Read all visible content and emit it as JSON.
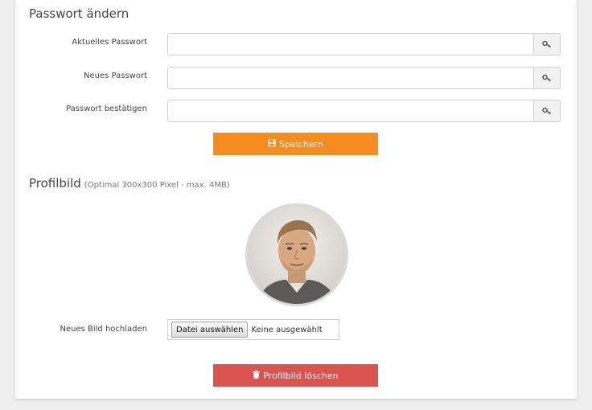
{
  "password_section": {
    "title": "Passwort ändern",
    "fields": [
      {
        "label": "Aktuelles Passwort",
        "value": "",
        "icon": "key-icon"
      },
      {
        "label": "Neues Passwort",
        "value": "",
        "icon": "key-icon"
      },
      {
        "label": "Passwort bestätigen",
        "value": "",
        "icon": "key-icon"
      }
    ],
    "save_label": "Speichern",
    "save_icon": "save-icon",
    "save_color": "#f68b1f"
  },
  "picture_section": {
    "title": "Profilbild",
    "hint": "(Optimal 300x300 Pixel - max. 4MB)",
    "upload_label": "Neues Bild hochladen",
    "file_button_label": "Datei auswählen",
    "file_status": "Keine ausgewählt",
    "delete_label": "Profilbild löschen",
    "delete_icon": "trash-icon",
    "delete_color": "#d9534f"
  }
}
